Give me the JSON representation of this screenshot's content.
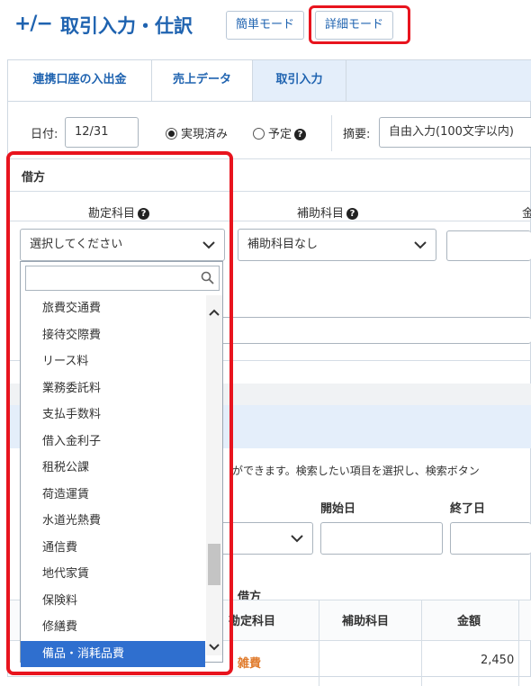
{
  "header": {
    "logo": "+/−",
    "title": "取引入力・仕訳",
    "mode_simple": "簡単モード",
    "mode_detail": "詳細モード"
  },
  "tabs": [
    {
      "label": "連携口座の入出金"
    },
    {
      "label": "売上データ"
    },
    {
      "label": "取引入力"
    }
  ],
  "form": {
    "date_label": "日付:",
    "date_value": "12/31",
    "radio_done": "実現済み",
    "radio_plan": "予定",
    "summary_label": "摘要:",
    "summary_placeholder": "自由入力(100文字以内)"
  },
  "debit": {
    "section_label": "借方",
    "account_header": "勘定科目",
    "sub_header": "補助科目",
    "amount_header_partial": "金",
    "account_select": "選択してください",
    "sub_select": "補助科目なし"
  },
  "dropdown": {
    "items": [
      "旅費交通費",
      "接待交際費",
      "リース料",
      "業務委託料",
      "支払手数料",
      "借入金利子",
      "租税公課",
      "荷造運賃",
      "水道光熱費",
      "通信費",
      "地代家賃",
      "保険料",
      "修繕費",
      "備品・消耗品費"
    ],
    "selected": "備品・消耗品費"
  },
  "search": {
    "hint": "ができます。検索したい項目を選択し、検索ボタン",
    "start_label": "開始日",
    "end_label": "終了日"
  },
  "table": {
    "debit_group": "借方",
    "col_account": "勘定科目",
    "col_sub": "補助科目",
    "col_amount": "金額",
    "row_account": "雑費",
    "row_amount": "2,450"
  },
  "colors": {
    "accent": "#1f63b0",
    "highlight": "#e8141e",
    "selected": "#2f6fcf",
    "orange_text": "#e07b2c"
  }
}
